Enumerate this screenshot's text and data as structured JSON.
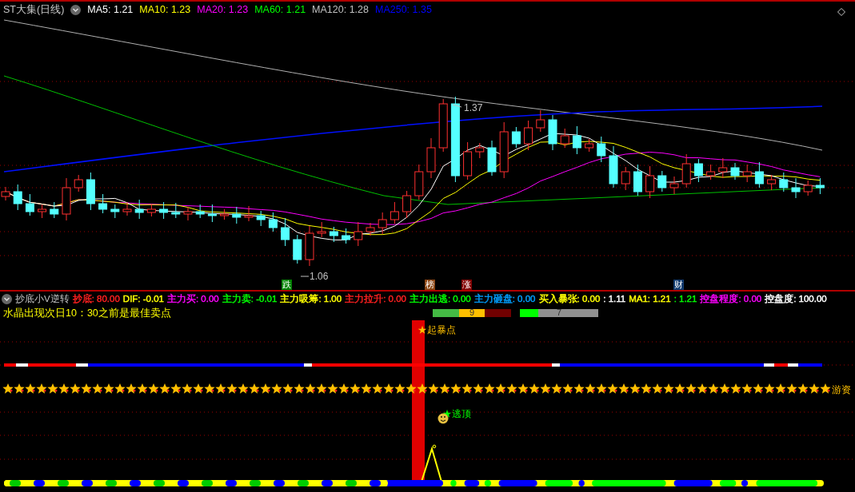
{
  "price_panel": {
    "title": "ST大集(日线)",
    "moving_averages": [
      {
        "text": "MA5: 1.21",
        "color": "#ffffff"
      },
      {
        "text": "MA10: 1.23",
        "color": "#ffff00"
      },
      {
        "text": "MA20: 1.23",
        "color": "#ff00ff"
      },
      {
        "text": "MA60: 1.21",
        "color": "#00ff00"
      },
      {
        "text": "MA120: 1.28",
        "color": "#c0c0c0"
      },
      {
        "text": "MA250: 1.35",
        "color": "#0000ff"
      }
    ],
    "high_label": "1.37",
    "low_label": "1.06",
    "signal_tags": [
      {
        "label": "跌",
        "color": "#008000"
      },
      {
        "label": "榜",
        "color": "#8b4513"
      },
      {
        "label": "涨",
        "color": "#800000"
      },
      {
        "label": "财",
        "color": "#103a6e"
      }
    ]
  },
  "indicator_panel": {
    "title": "抄底小V逆转",
    "values": [
      {
        "text": "抄底: 80.00",
        "color": "#ff2020"
      },
      {
        "text": "DIF: -0.01",
        "color": "#ffff00"
      },
      {
        "text": "主力买: 0.00",
        "color": "#ff00ff"
      },
      {
        "text": "主力卖: -0.01",
        "color": "#00ff00"
      },
      {
        "text": "主力吸筹: 1.00",
        "color": "#ffff00"
      },
      {
        "text": "主力拉升: 0.00",
        "color": "#ff2020"
      },
      {
        "text": "主力出逃: 0.00",
        "color": "#00ff00"
      },
      {
        "text": "主力砸盘: 0.00",
        "color": "#00a0ff"
      },
      {
        "text": "买入暴张: 0.00",
        "color": "#ffff00"
      },
      {
        "text": ": 1.11",
        "color": "#ffffff"
      },
      {
        "text": "MA1: 1.21",
        "color": "#ffff00"
      },
      {
        "text": ": 1.21",
        "color": "#00ff00"
      },
      {
        "text": "控盘程度: 0.00",
        "color": "#ff00ff"
      },
      {
        "text": "控盘度: 100.00",
        "color": "#ffffff"
      }
    ],
    "note": "水晶出现次日10：30之前是最佳卖点",
    "bars": [
      {
        "kind": "segmented",
        "label": "9",
        "segments": [
          {
            "color": "#44bb44"
          },
          {
            "color": "#ffc000"
          },
          {
            "color": "#700000"
          }
        ]
      },
      {
        "kind": "meter",
        "label": "7",
        "level": 0.23
      }
    ],
    "signals": {
      "burst": "★起暴点",
      "escape": "★逃顶",
      "band": "游资"
    }
  }
}
